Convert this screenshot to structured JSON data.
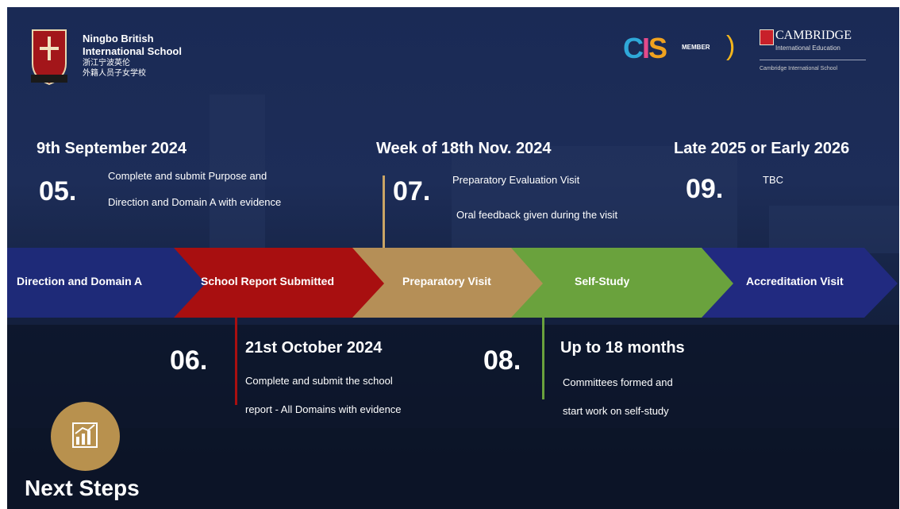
{
  "header": {
    "school_name_line1": "Ningbo British",
    "school_name_line2": "International School",
    "school_cn_line1": "浙江宁波英伦",
    "school_cn_line2": "外籍人员子女学校",
    "cis_logo_text": "CIS",
    "cis_member": "MEMBER",
    "cambridge_title": "CAMBRIDGE",
    "cambridge_sub": "International Education",
    "cambridge_sub2": "Cambridge International School"
  },
  "steps": {
    "s05": {
      "number": "05.",
      "date": "9th September 2024",
      "line1": "Complete and submit Purpose and",
      "line2": "Direction and Domain A with evidence"
    },
    "s06": {
      "number": "06.",
      "date": "21st October 2024",
      "line1": "Complete and submit the school",
      "line2": "report - All Domains with evidence"
    },
    "s07": {
      "number": "07.",
      "date": "Week of 18th Nov. 2024",
      "line1": "Preparatory Evaluation Visit",
      "line2": "Oral feedback given during the visit"
    },
    "s08": {
      "number": "08.",
      "date": "Up to 18 months",
      "line1": "Committees formed and",
      "line2": "start work on self-study"
    },
    "s09": {
      "number": "09.",
      "date": "Late 2025 or Early 2026",
      "line1": "TBC"
    }
  },
  "timeline": {
    "stages": [
      {
        "label": "Direction and Domain A",
        "color": "#1e2a78"
      },
      {
        "label": "School Report Submitted",
        "color": "#a80f10"
      },
      {
        "label": "Preparatory Visit",
        "color": "#b58f57"
      },
      {
        "label": "Self-Study",
        "color": "#6aa23d"
      },
      {
        "label": "Accreditation Visit",
        "color": "#212a80"
      }
    ]
  },
  "footer": {
    "title": "Next Steps",
    "icon": "chart-growth-icon",
    "icon_color": "#b8914e"
  }
}
